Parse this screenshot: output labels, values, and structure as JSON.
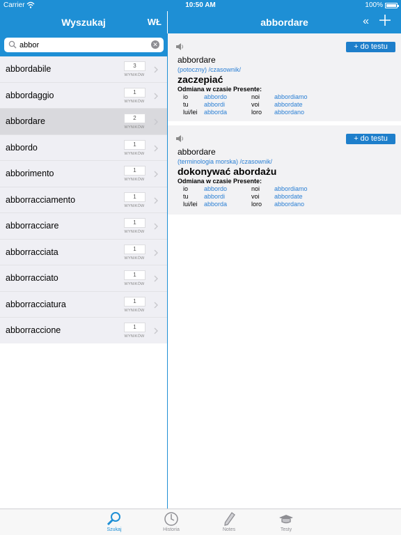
{
  "status": {
    "carrier": "Carrier",
    "time": "10:50 AM",
    "battery": "100%",
    "battery_level": 1.0
  },
  "left_nav": {
    "title": "Wyszukaj",
    "toggle": "WŁ"
  },
  "search": {
    "value": "abbor"
  },
  "list": [
    {
      "word": "abbordabile",
      "count": "3",
      "unit": "WYNIKÓW"
    },
    {
      "word": "abbordaggio",
      "count": "1",
      "unit": "WYNIKÓW"
    },
    {
      "word": "abbordare",
      "count": "2",
      "unit": "WYNIKÓW",
      "selected": true
    },
    {
      "word": "abbordo",
      "count": "1",
      "unit": "WYNIKÓW"
    },
    {
      "word": "abborimento",
      "count": "1",
      "unit": "WYNIKÓW"
    },
    {
      "word": "abborracciamento",
      "count": "1",
      "unit": "WYNIKÓW"
    },
    {
      "word": "abborracciare",
      "count": "1",
      "unit": "WYNIKÓW"
    },
    {
      "word": "abborracciata",
      "count": "1",
      "unit": "WYNIKÓW"
    },
    {
      "word": "abborracciato",
      "count": "1",
      "unit": "WYNIKÓW"
    },
    {
      "word": "abborracciatura",
      "count": "1",
      "unit": "WYNIKÓW"
    },
    {
      "word": "abborraccione",
      "count": "1",
      "unit": "WYNIKÓW"
    }
  ],
  "right_nav": {
    "title": "abbordare",
    "collapse": "«"
  },
  "entries": [
    {
      "add_label": "+ do testu",
      "headword": "abbordare",
      "tags": "(potoczny) /czasownik/",
      "translation": "zaczepiać",
      "conj_title": "Odmiana w czasie Presente:",
      "conj": [
        {
          "p1": "io",
          "f1": "abbordo",
          "p2": "noi",
          "f2": "abbordiamo"
        },
        {
          "p1": "tu",
          "f1": "abbordi",
          "p2": "voi",
          "f2": "abbordate"
        },
        {
          "p1": "lui/lei",
          "f1": "abborda",
          "p2": "loro",
          "f2": "abbordano"
        }
      ]
    },
    {
      "add_label": "+ do testu",
      "headword": "abbordare",
      "tags": "(terminologia morska) /czasownik/",
      "translation": "dokonywać abordażu",
      "conj_title": "Odmiana w czasie Presente:",
      "conj": [
        {
          "p1": "io",
          "f1": "abbordo",
          "p2": "noi",
          "f2": "abbordiamo"
        },
        {
          "p1": "tu",
          "f1": "abbordi",
          "p2": "voi",
          "f2": "abbordate"
        },
        {
          "p1": "lui/lei",
          "f1": "abborda",
          "p2": "loro",
          "f2": "abbordano"
        }
      ]
    }
  ],
  "tabs": [
    {
      "label": "Szukaj",
      "icon": "search-icon",
      "active": true
    },
    {
      "label": "Historia",
      "icon": "clock-icon"
    },
    {
      "label": "Notes",
      "icon": "pen-icon"
    },
    {
      "label": "Testy",
      "icon": "graduation-cap-icon"
    }
  ],
  "colors": {
    "accent": "#1e8fd5",
    "link": "#2a7fd4",
    "button": "#1e7fcb"
  }
}
